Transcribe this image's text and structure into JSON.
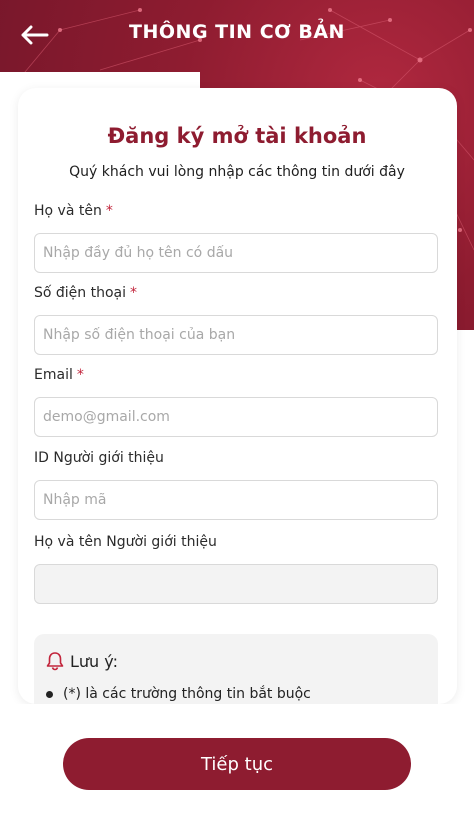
{
  "header": {
    "title": "THÔNG TIN CƠ BẢN",
    "back_icon": "arrow-left-icon"
  },
  "card": {
    "title": "Đăng ký mở tài khoản",
    "subtitle": "Quý khách vui lòng nhập các thông tin dưới đây"
  },
  "fields": {
    "full_name": {
      "label": "Họ và tên",
      "required_mark": "*",
      "placeholder": "Nhập đầy đủ họ tên có dấu",
      "value": ""
    },
    "phone": {
      "label": "Số điện thoại",
      "required_mark": "*",
      "placeholder": "Nhập số điện thoại của bạn",
      "value": ""
    },
    "email": {
      "label": "Email",
      "required_mark": "*",
      "placeholder": "demo@gmail.com",
      "value": ""
    },
    "referrer_id": {
      "label": "ID Người giới thiệu",
      "placeholder": "Nhập mã",
      "value": ""
    },
    "referrer_name": {
      "label": "Họ và tên Người giới thiệu",
      "value": ""
    }
  },
  "note": {
    "title": "Lưu ý:",
    "icon": "bell-icon",
    "items": [
      "(*) là các trường thông tin bắt buộc"
    ]
  },
  "footer": {
    "continue_label": "Tiếp tục"
  },
  "colors": {
    "brand": "#8e1c30",
    "required": "#c2243b"
  }
}
